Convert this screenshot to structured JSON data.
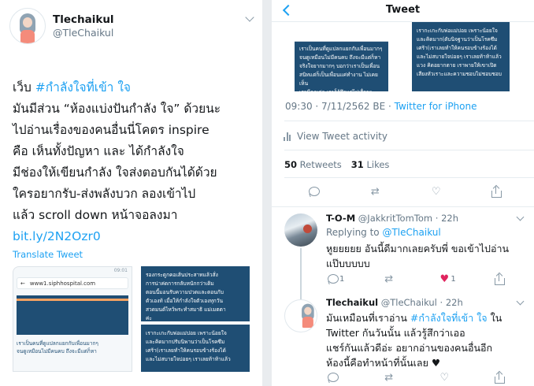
{
  "left": {
    "author": {
      "name": "Tlechaikul",
      "handle": "@TleChaikul"
    },
    "text_lines": [
      "เว็บ ",
      "มันมีส่วน “ห้องแบ่งปันกำลัง ใจ” ด้วยนะ",
      "ไปอ่านเรื่องของคนอื่นนี่โคตร inspire",
      "คือ เห็นทั้งปัญหา และ ได้กำลังใจ",
      "มีช่องให้เขียนกำลัง ใจส่งตอบกันได้ด้วย",
      " ใครอยากรับ-ส่งพลังบวก ลองเข้าไป",
      " แล้ว scroll down หน้าจอลงมา"
    ],
    "hashtag": "#กำลังใจที่เข้า ใจ",
    "link": "bit.ly/2N2Ozr0",
    "translate": "Translate Tweet",
    "media": {
      "status_time": "09:01",
      "url": "www1.siphhospital.com",
      "doc_text": "เราเป็นคนที่ดูแปลกแยกกับเพื่อนมากๆ\nจนดูเหมือนไม่มีคนคบ ถึงจะมีแต่ก็หา",
      "card_top": "รองกระดูกคอเส้นประสาทแล้วสั่ง\nการน่าค่ดการกลับหนักกว่าเดิม\nตอนนี้มอนรับความปวดและตอนกับ\nตัวเองท้ เมื่อให้กำลังใจตัวเองทุกวัน\nสวดมนต์ไหว้พระทำสมาธิ แม่เมตตา\nค่ะ",
      "card_bottom": "เรากะเกะกับพ่อแม่บ่อย เพราะน้อยใจ\nและคิดมากปรับนิพานว่าเป็นโรคซึม\nเศร้า(เราเลยทำให้คนรอบข้างร้องได้\nและไม่สบายใจบ่อยๆ เราเลยท้าท้าแล้ว"
    }
  },
  "right": {
    "title": "Tweet",
    "images": {
      "a_text": "เราเป็นคนที่ดูแปลกแยกกับเพื่อนมากๆ\nจนดูเหมือนไม่มีคนคบ ถึงจะมีแต่ก็หา\nจริงใจยากมากๆ บอกว่าเราเป็นเพื่อน\nสนิทแต่ก็เป็นเพื่อนแค่ทำงาน ไม่เคยเห็น\nเรามีคุณค่า เราก็รู้สึกแย่ไปเรื่อยๆ\nเราเลย สิ่งที่พยายามจะเข้าสังคม",
      "b_text": "เรากะเกะกับพ่อแม่บ่อย เพราะน้อยใจ\nและคิดมาก(ดับนิจฐานว่าเป็นโรคซึม\nเศร้า(เราเลยทำให้คนรอบข้างร้องได้\nและไม่สบายใจบ่อยๆ เราเลยท้าท้าแล้ว\nแวง คิดอยากตาย เราพายให้เขาเปิด\nเสียงหัวเราะและความชอบไม่ชอบชอบ"
    },
    "meta": {
      "datetime": "09:30 · 7/11/2562 BE · ",
      "source": "Twitter for iPhone"
    },
    "activity": "View Tweet activity",
    "stats": {
      "retweets_count": "50",
      "retweets_label": "Retweets",
      "likes_count": "31",
      "likes_label": "Likes"
    },
    "replies": [
      {
        "name": "T-O-M",
        "handle": "@JakkritTomTom · 22h",
        "replying_label": "Replying to ",
        "replying_handle": "@TleChaikul",
        "text": "หูยยยยย อันนี้ดีมากเลยครับพี่ ขอเข้าไปอ่าน\nแป๊บบบบบ",
        "reply_count": "1",
        "like_count": "1"
      },
      {
        "name": "Tlechaikul",
        "handle": "@TleChaikul · 22h",
        "text_before": "มันเหมือนที่เราอ่าน ",
        "hashtag": "#กำลังใจที่เข้า ใจ",
        "text_after": " ใน\nTwitter กันวันนั้น แล้วรู้สึกว่าเออ\nแชร์กันแล้วดีอ่ะ อยากอ่านของคนอื่นอีก\nห้องนี้คือทำหน้าที่นั้นเลย ♥"
      }
    ]
  },
  "colors": {
    "accent": "#1da1f2",
    "like": "#e0245e",
    "navy": "#1f4e74"
  }
}
